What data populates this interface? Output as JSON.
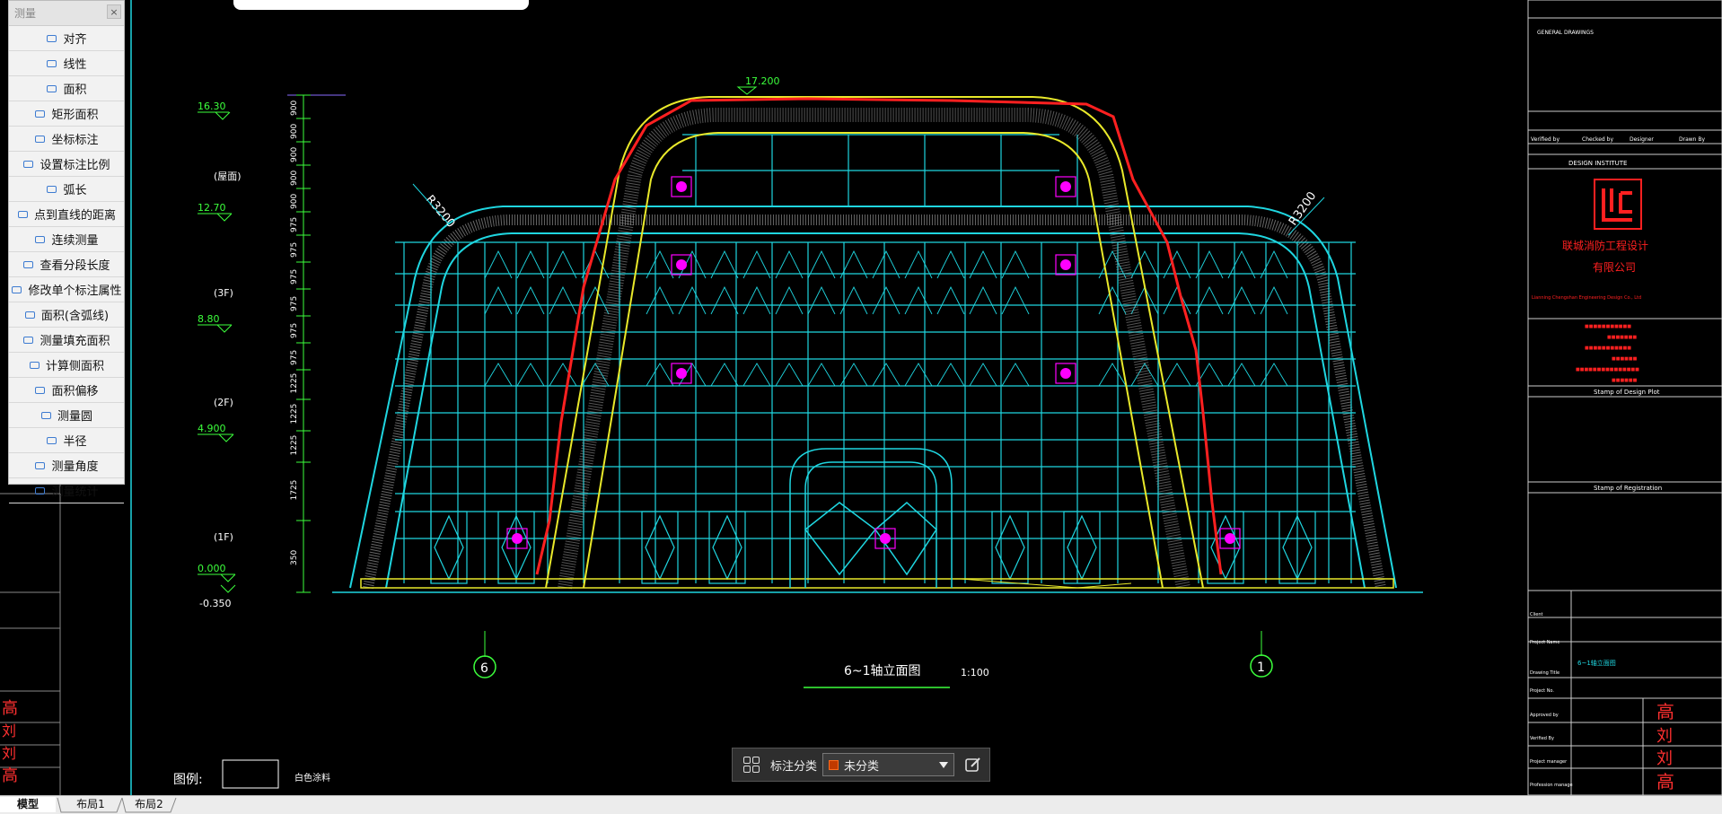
{
  "measure_panel": {
    "title": "测量",
    "close": "×",
    "items": [
      {
        "label": "对齐",
        "icon": "align-measure-icon"
      },
      {
        "label": "线性",
        "icon": "linear-measure-icon"
      },
      {
        "label": "面积",
        "icon": "area-icon"
      },
      {
        "label": "矩形面积",
        "icon": "rect-area-icon"
      },
      {
        "label": "坐标标注",
        "icon": "coordinate-icon"
      },
      {
        "label": "设置标注比例",
        "icon": "scale-icon"
      },
      {
        "label": "弧长",
        "icon": "arc-length-icon"
      },
      {
        "label": "点到直线的距离",
        "icon": "point-line-distance-icon"
      },
      {
        "label": "连续测量",
        "icon": "continuous-measure-icon"
      },
      {
        "label": "查看分段长度",
        "icon": "segment-length-icon"
      },
      {
        "label": "修改单个标注属性",
        "icon": "edit-annotation-icon"
      },
      {
        "label": "面积(含弧线)",
        "icon": "arc-area-icon"
      },
      {
        "label": "测量填充面积",
        "icon": "fill-area-icon"
      },
      {
        "label": "计算侧面积",
        "icon": "side-area-icon"
      },
      {
        "label": "面积偏移",
        "icon": "area-offset-icon"
      },
      {
        "label": "测量圆",
        "icon": "circle-measure-icon"
      },
      {
        "label": "半径",
        "icon": "radius-icon"
      },
      {
        "label": "测量角度",
        "icon": "angle-icon"
      },
      {
        "label": "测量统计",
        "icon": "statistics-icon"
      }
    ]
  },
  "drawing": {
    "levels": [
      {
        "value": "16.30",
        "floor": ""
      },
      {
        "value": "",
        "floor": "(屋面)"
      },
      {
        "value": "12.70",
        "floor": ""
      },
      {
        "value": "",
        "floor": "(3F)"
      },
      {
        "value": "8.80",
        "floor": ""
      },
      {
        "value": "",
        "floor": "(2F)"
      },
      {
        "value": "4.900",
        "floor": ""
      },
      {
        "value": "",
        "floor": "(1F)"
      },
      {
        "value": "0.000",
        "floor": ""
      },
      {
        "value": "-0.350",
        "floor": ""
      }
    ],
    "dims": [
      "900",
      "900",
      "900",
      "900",
      "900",
      "975",
      "975",
      "975",
      "975",
      "975",
      "975",
      "1225",
      "1225",
      "1225",
      "1725",
      "350"
    ],
    "top_level": "17.200",
    "radius_left": "R3200",
    "radius_right": "R3200",
    "axis_left": "6",
    "axis_right": "1",
    "title": "6~1轴立面图",
    "scale": "1:100",
    "legend_label": "图例:",
    "legend_text": "白色涂料"
  },
  "title_block": {
    "general_drawings": "GENERAL DRAWINGS",
    "design_institute": "DESIGN INSTITUTE",
    "company_cn_1": "联城消防工程设计",
    "company_cn_2": "有限公司",
    "company_en": "Lianning Chengshan Engineering Design Co., Ltd",
    "stamp_design": "Stamp of Design Plot",
    "stamp_registration": "Stamp of Registration",
    "verified_by": "Verified by",
    "checked_by": "Checked by",
    "designer": "Designer",
    "drawn_by": "Drawn By",
    "client": "Client",
    "project_name": "Project Name",
    "drawing_title": "Drawing Title",
    "drawing_title_value": "6~1轴立面图",
    "project_no": "Project No.",
    "approved_by": "Approved by",
    "verified_by2": "Verified By",
    "project_manager": "Project manager",
    "profession": "Profession manage"
  },
  "anno_bar": {
    "label": "标注分类",
    "selected": "未分类",
    "accent": "#ff6a1a"
  },
  "tabs": [
    {
      "label": "模型",
      "active": true
    },
    {
      "label": "布局1",
      "active": false
    },
    {
      "label": "布局2",
      "active": false
    }
  ],
  "colors": {
    "cyan": "#1fd6e0",
    "yellow": "#e9e92a",
    "green": "#3cff3c",
    "magenta": "#ff00ff",
    "red": "#ff2020",
    "white": "#ffffff"
  }
}
